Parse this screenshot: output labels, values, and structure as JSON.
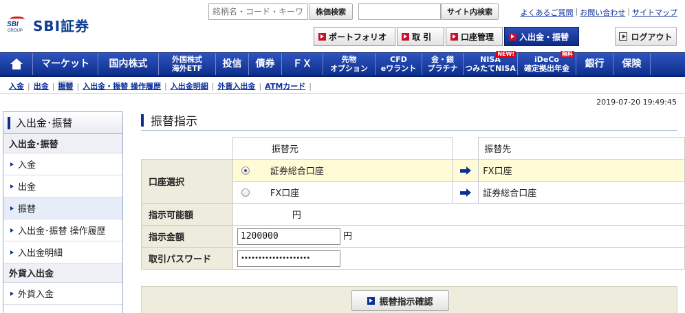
{
  "brand": {
    "mark_text": "SBI",
    "mark_sub": "GROUP",
    "name": "SBI証券"
  },
  "search": {
    "stock_placeholder": "銘柄名・コード・キーワード",
    "stock_button": "株価検索",
    "site_placeholder": "",
    "site_button": "サイト内検索"
  },
  "top_links": [
    "よくあるご質問",
    "お問い合わせ",
    "サイトマップ"
  ],
  "header_tabs": [
    {
      "label": "ポートフォリオ",
      "active": false
    },
    {
      "label": "取 引",
      "active": false
    },
    {
      "label": "口座管理",
      "active": false
    },
    {
      "label": "入出金・振替",
      "active": true
    }
  ],
  "logout_label": "ログアウト",
  "main_nav": [
    {
      "label": "home",
      "icon": "home-icon"
    },
    {
      "label": "マーケット"
    },
    {
      "label": "国内株式"
    },
    {
      "label": "外国株式",
      "label2": "海外ETF"
    },
    {
      "label": "投信"
    },
    {
      "label": "債券"
    },
    {
      "label": "ＦＸ"
    },
    {
      "label": "先物",
      "label2": "オプション"
    },
    {
      "label": "CFD",
      "label2": "eワラント"
    },
    {
      "label": "金・銀",
      "label2": "プラチナ"
    },
    {
      "label": "NISA",
      "label2": "つみたてNISA",
      "badge": "NEW!"
    },
    {
      "label": "iDeCo",
      "label2": "確定拠出年金",
      "badge": "無料"
    },
    {
      "label": "銀行"
    },
    {
      "label": "保険"
    }
  ],
  "sub_nav": [
    {
      "label": "入金",
      "active": false
    },
    {
      "label": "出金",
      "active": false
    },
    {
      "label": "振替",
      "active": true
    },
    {
      "label": "入出金・振替 操作履歴",
      "active": false
    },
    {
      "label": "入出金明細",
      "active": false
    },
    {
      "label": "外貨入出金",
      "active": false
    },
    {
      "label": "ATMカード",
      "active": false
    }
  ],
  "timestamp": "2019-07-20 19:49:45",
  "sidebar": {
    "title": "入出金･振替",
    "section1": "入出金･振替",
    "items1": [
      "入金",
      "出金",
      "振替",
      "入出金･振替 操作履歴",
      "入出金明細"
    ],
    "section2": "外貨入出金",
    "items2": [
      "外貨入金"
    ]
  },
  "page_title": "振替指示",
  "transfer": {
    "col_from": "振替元",
    "col_to": "振替先",
    "account_select_label": "口座選択",
    "rows": [
      {
        "from": "証券総合口座",
        "to": "FX口座",
        "selected": true
      },
      {
        "from": "FX口座",
        "to": "証券総合口座",
        "selected": false
      }
    ],
    "available_label": "指示可能額",
    "available_unit": "円",
    "amount_label": "指示金額",
    "amount_value": "1200000",
    "amount_unit": "円",
    "password_label": "取引パスワード",
    "password_value": "••••••••••••••••••••"
  },
  "confirm_button": "振替指示確認",
  "colors": {
    "brand_blue": "#0d2f8d",
    "accent_red": "#c8102e",
    "label_bg": "#eeecdd",
    "highlight": "#fffbd6"
  }
}
